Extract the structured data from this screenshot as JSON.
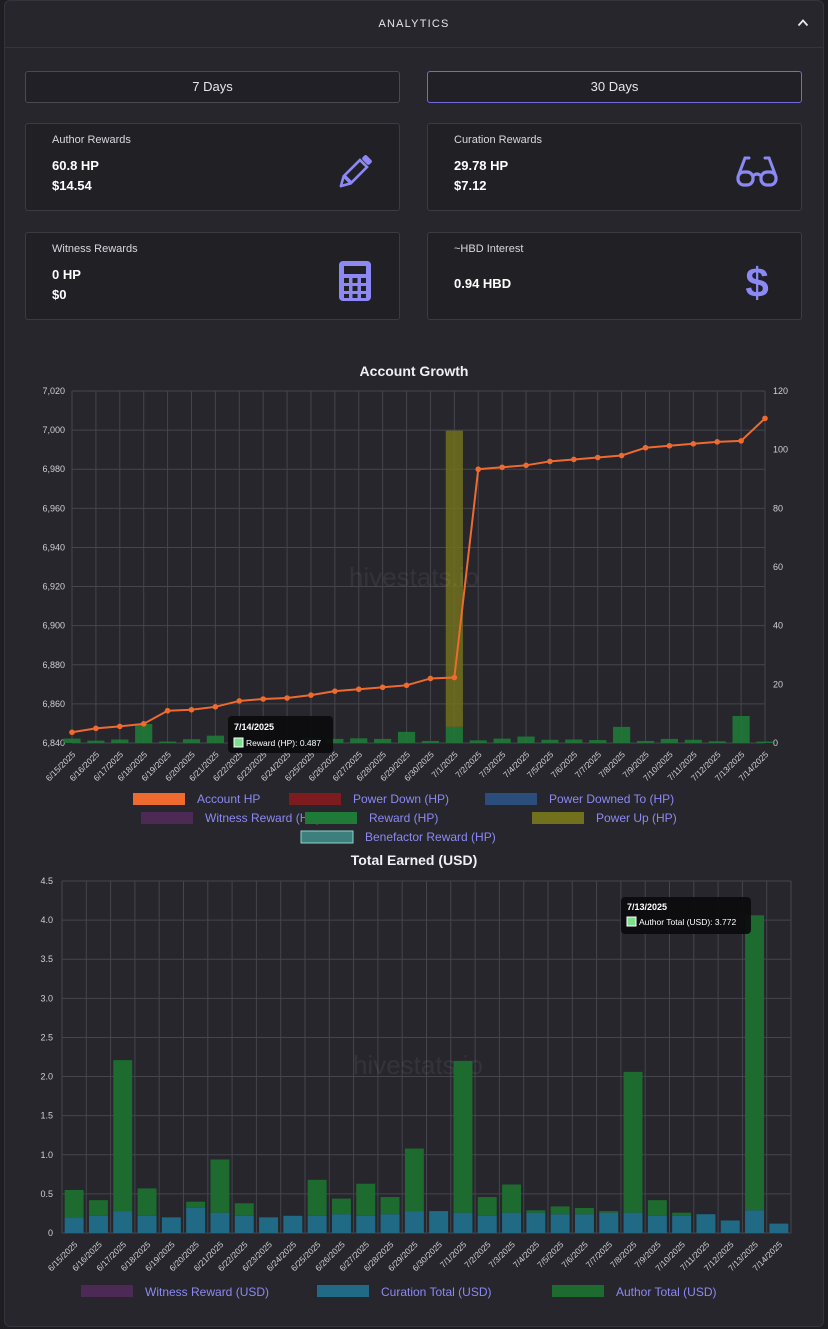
{
  "header": {
    "title": "ANALYTICS"
  },
  "tabs": [
    {
      "label": "7 Days",
      "active": false
    },
    {
      "label": "30 Days",
      "active": true
    }
  ],
  "cards": [
    {
      "title": "Author Rewards",
      "line1": "60.8 HP",
      "line2": "$14.54",
      "icon": "pencil-icon"
    },
    {
      "title": "Curation Rewards",
      "line1": "29.78 HP",
      "line2": "$7.12",
      "icon": "glasses-icon"
    },
    {
      "title": "Witness Rewards",
      "line1": "0 HP",
      "line2": "$0",
      "icon": "calculator-icon"
    },
    {
      "title": "~HBD Interest",
      "line1": "0.94 HBD",
      "line2": "",
      "icon": "dollar-icon"
    }
  ],
  "watermark": "hivestats.io",
  "colors": {
    "accent": "#8c89f5",
    "account_hp": "#ef6a2e",
    "power_down": "#7d1b1f",
    "powered_to": "#2a4d7c",
    "witness": "#4d2a55",
    "reward": "#1f7a37",
    "power_up": "#71711d",
    "benefactor": "#3d7f7c",
    "curation": "#216a86",
    "author": "#1e6b2f",
    "legend_text": "#8c89f5"
  },
  "chart_data": [
    {
      "type": "line",
      "title": "Account Growth",
      "x": [
        "6/15/2025",
        "6/16/2025",
        "6/17/2025",
        "6/18/2025",
        "6/19/2025",
        "6/20/2025",
        "6/21/2025",
        "6/22/2025",
        "6/23/2025",
        "6/24/2025",
        "6/25/2025",
        "6/26/2025",
        "6/27/2025",
        "6/28/2025",
        "6/29/2025",
        "6/30/2025",
        "7/1/2025",
        "7/2/2025",
        "7/3/2025",
        "7/4/2025",
        "7/5/2025",
        "7/6/2025",
        "7/7/2025",
        "7/8/2025",
        "7/9/2025",
        "7/10/2025",
        "7/11/2025",
        "7/12/2025",
        "7/13/2025",
        "7/14/2025"
      ],
      "ylim": [
        6840,
        7020
      ],
      "yticks": [
        "7,020",
        "7,000",
        "6,980",
        "6,960",
        "6,940",
        "6,920",
        "6,900",
        "6,880",
        "6,860",
        "6,840"
      ],
      "y2lim": [
        0,
        120
      ],
      "y2ticks": [
        "120",
        "100",
        "80",
        "60",
        "40",
        "20",
        "0"
      ],
      "grid": true,
      "legend_position": "bottom",
      "series": [
        {
          "name": "Account HP",
          "axis": "left",
          "kind": "line",
          "values": [
            6845.5,
            6847.5,
            6848.5,
            6849.8,
            6856.5,
            6857,
            6858.5,
            6861.5,
            6862.5,
            6863,
            6864.5,
            6866.5,
            6867.5,
            6868.5,
            6869.5,
            6873,
            6873.5,
            6980,
            6981,
            6982,
            6984,
            6985,
            6986,
            6987,
            6991,
            6992,
            6993,
            6994,
            6994.5,
            7006
          ]
        },
        {
          "name": "Power Down (HP)",
          "axis": "right",
          "kind": "bar",
          "values": []
        },
        {
          "name": "Power Downed To (HP)",
          "axis": "right",
          "kind": "bar",
          "values": []
        },
        {
          "name": "Witness Reward (HP)",
          "axis": "right",
          "kind": "bar",
          "values": []
        },
        {
          "name": "Reward (HP)",
          "axis": "right",
          "kind": "bar",
          "values": [
            1.5,
            0.8,
            1.2,
            6.5,
            0.5,
            1.3,
            2.5,
            0.9,
            0.5,
            0.8,
            1.8,
            1.4,
            1.6,
            1.4,
            3.8,
            0.7,
            5.5,
            0.9,
            1.5,
            2.2,
            1.1,
            1.2,
            1,
            5.5,
            0.7,
            1.4,
            1.1,
            0.6,
            9.2,
            0.487
          ]
        },
        {
          "name": "Power Up (HP)",
          "axis": "right",
          "kind": "bar",
          "values": [
            0,
            0,
            0,
            0,
            0,
            0,
            0,
            0,
            0,
            0,
            0,
            0,
            0,
            0,
            0,
            0,
            101,
            0,
            0,
            0,
            0,
            0,
            0,
            0,
            0,
            0,
            0,
            0,
            0,
            0
          ]
        },
        {
          "name": "Benefactor Reward (HP)",
          "axis": "right",
          "kind": "bar",
          "values": []
        }
      ],
      "tooltip": {
        "title": "7/14/2025",
        "text": "Reward (HP): 0.487"
      }
    },
    {
      "type": "bar",
      "stacked": true,
      "title": "Total Earned (USD)",
      "x": [
        "6/15/2025",
        "6/16/2025",
        "6/17/2025",
        "6/18/2025",
        "6/19/2025",
        "6/20/2025",
        "6/21/2025",
        "6/22/2025",
        "6/23/2025",
        "6/24/2025",
        "6/25/2025",
        "6/26/2025",
        "6/27/2025",
        "6/28/2025",
        "6/29/2025",
        "6/30/2025",
        "7/1/2025",
        "7/2/2025",
        "7/3/2025",
        "7/4/2025",
        "7/5/2025",
        "7/6/2025",
        "7/7/2025",
        "7/8/2025",
        "7/9/2025",
        "7/10/2025",
        "7/11/2025",
        "7/12/2025",
        "7/13/2025",
        "7/14/2025"
      ],
      "ylim": [
        0,
        4.5
      ],
      "yticks": [
        "4.5",
        "4.0",
        "3.5",
        "3.0",
        "2.5",
        "2.0",
        "1.5",
        "1.0",
        "0.5",
        "0"
      ],
      "grid": true,
      "legend_position": "bottom",
      "series": [
        {
          "name": "Witness Reward (USD)",
          "values": []
        },
        {
          "name": "Curation Total (USD)",
          "values": [
            0.2,
            0.22,
            0.28,
            0.22,
            0.2,
            0.32,
            0.26,
            0.22,
            0.2,
            0.22,
            0.22,
            0.24,
            0.22,
            0.24,
            0.28,
            0.28,
            0.26,
            0.22,
            0.26,
            0.26,
            0.24,
            0.24,
            0.26,
            0.26,
            0.22,
            0.22,
            0.24,
            0.16,
            0.29,
            0.12
          ]
        },
        {
          "name": "Author Total (USD)",
          "values": [
            0.35,
            0.2,
            1.93,
            0.35,
            0,
            0.08,
            0.68,
            0.16,
            0,
            0,
            0.46,
            0.2,
            0.41,
            0.22,
            0.8,
            0,
            1.94,
            0.24,
            0.36,
            0.03,
            0.1,
            0.08,
            0.02,
            1.8,
            0.2,
            0.04,
            0,
            0,
            3.772,
            0
          ]
        }
      ],
      "tooltip": {
        "title": "7/13/2025",
        "text": "Author Total (USD): 3.772"
      }
    }
  ]
}
